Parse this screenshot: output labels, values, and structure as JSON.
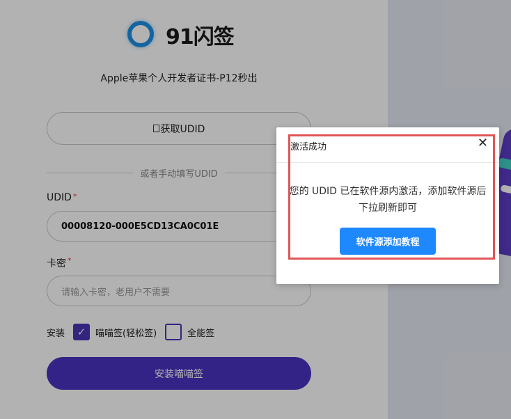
{
  "brand": {
    "name": "91闪签",
    "subtitle": "Apple苹果个人开发者证书-P12秒出"
  },
  "form": {
    "get_udid_label": "获取UDID",
    "divider_text": "或者手动填写UDID",
    "udid_label": "UDID",
    "udid_value": "00008120-000E5CD13CA0C01E",
    "card_label": "卡密",
    "card_placeholder": "请输入卡密，老用户不需要",
    "required_mark": "*",
    "install_label": "安装",
    "option_meow": "喵喵签(轻松签)",
    "option_all": "全能签",
    "install_button": "安装喵喵签"
  },
  "modal": {
    "title": "激活成功",
    "close_glyph": "✕",
    "message": "您的 UDID 已在软件源内激活，添加软件源后下拉刷新即可",
    "button": "软件源添加教程"
  },
  "colors": {
    "accent": "#4b33c0",
    "modal_button": "#1e88ff",
    "highlight": "#e05555",
    "logo": "#1e90e6"
  },
  "icons": {
    "checkmark": "✓"
  }
}
